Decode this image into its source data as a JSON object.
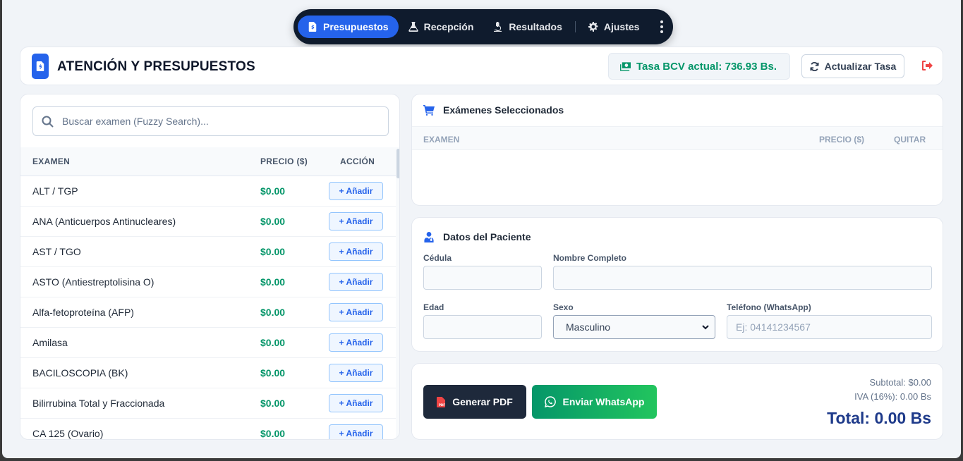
{
  "nav": {
    "items": [
      {
        "label": "Presupuestos",
        "icon": "file-invoice-icon",
        "active": true
      },
      {
        "label": "Recepción",
        "icon": "flask-icon",
        "active": false
      },
      {
        "label": "Resultados",
        "icon": "microscope-icon",
        "active": false
      },
      {
        "label": "Ajustes",
        "icon": "gear-icon",
        "active": false
      }
    ],
    "more_icon": "vertical-dots-icon"
  },
  "header": {
    "title": "ATENCIÓN Y PRESUPUESTOS",
    "rate": "Tasa BCV actual: 736.93 Bs.",
    "refresh_label": "Actualizar Tasa"
  },
  "exams": {
    "search_placeholder": "Buscar examen (Fuzzy Search)...",
    "columns": {
      "name": "EXAMEN",
      "price": "PRECIO ($)",
      "action": "ACCIÓN"
    },
    "rows": [
      {
        "name": "ALT / TGP",
        "price": "$0.00",
        "action": "+ Añadir"
      },
      {
        "name": "ANA (Anticuerpos Antinucleares)",
        "price": "$0.00",
        "action": "+ Añadir"
      },
      {
        "name": "AST / TGO",
        "price": "$0.00",
        "action": "+ Añadir"
      },
      {
        "name": "ASTO (Antiestreptolisina O)",
        "price": "$0.00",
        "action": "+ Añadir"
      },
      {
        "name": "Alfa-fetoproteína (AFP)",
        "price": "$0.00",
        "action": "+ Añadir"
      },
      {
        "name": "Amilasa",
        "price": "$0.00",
        "action": "+ Añadir"
      },
      {
        "name": "BACILOSCOPIA (BK)",
        "price": "$0.00",
        "action": "+ Añadir"
      },
      {
        "name": "Bilirrubina Total y Fraccionada",
        "price": "$0.00",
        "action": "+ Añadir"
      },
      {
        "name": "CA 125 (Ovario)",
        "price": "$0.00",
        "action": "+ Añadir"
      }
    ]
  },
  "selected": {
    "title": "Exámenes Seleccionados",
    "columns": {
      "name": "EXAMEN",
      "price": "PRECIO ($)",
      "remove": "QUITAR"
    }
  },
  "patient": {
    "title": "Datos del Paciente",
    "cedula_label": "Cédula",
    "cedula_value": "",
    "nombre_label": "Nombre Completo",
    "nombre_value": "",
    "edad_label": "Edad",
    "edad_value": "",
    "sexo_label": "Sexo",
    "sexo_value": "Masculino",
    "telefono_label": "Teléfono (WhatsApp)",
    "telefono_placeholder": "Ej: 04141234567"
  },
  "totals": {
    "pdf_label": "Generar PDF",
    "whatsapp_label": "Enviar WhatsApp",
    "subtotal": "Subtotal: $0.00",
    "iva": "IVA (16%): 0.00 Bs",
    "total": "Total: 0.00 Bs"
  },
  "colors": {
    "accent": "#2563eb",
    "nav_bg": "#0f1b2d",
    "price_green": "#059669",
    "logout_red": "#ef4444",
    "total_navy": "#1e3a8a"
  }
}
